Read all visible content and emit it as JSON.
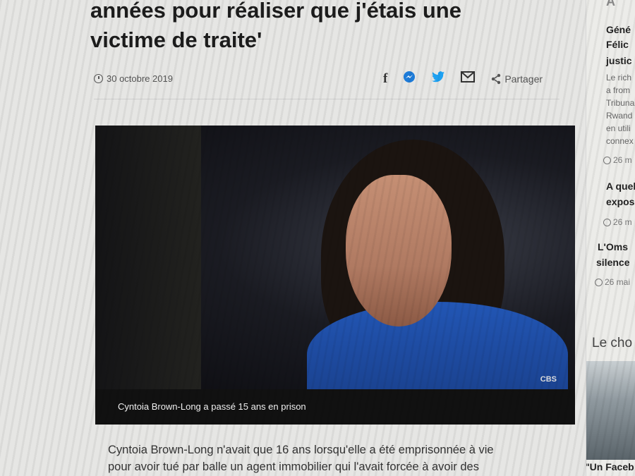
{
  "article": {
    "headline_line1": "années pour réaliser que j'étais une",
    "headline_line2": "victime de traite'",
    "date": "30 octobre 2019",
    "share_label": "Partager",
    "caption": "Cyntoia Brown-Long a passé 15 ans en prison",
    "image_credit": "CBS",
    "body_line1": "Cyntoia Brown-Long n'avait que 16 ans lorsqu'elle a été emprisonnée à vie",
    "body_line2": "pour avoir tué par balle un agent immobilier qui l'avait forcée à avoir des"
  },
  "share_icons": [
    "facebook-icon",
    "messenger-icon",
    "twitter-icon",
    "email-icon",
    "share-icon"
  ],
  "sidebar": {
    "top_partial": "A",
    "story1": {
      "line1": "Géné",
      "line2": "Félic",
      "line3": "justic",
      "snippet": [
        "Le rich",
        "a from",
        "Tribuna",
        "Rwand",
        "en utili",
        "connex"
      ],
      "time": "26 m"
    },
    "story2": {
      "line1": "A quel",
      "line2": "expose",
      "time": "26 m"
    },
    "story3": {
      "line1": "L'Oms",
      "line2": "silence",
      "time": "26 mai"
    },
    "section_title": "Le cho",
    "thumb_title": "\"Un Faceb"
  },
  "colors": {
    "messenger": "#1d7bd8",
    "twitter": "#1da1f2",
    "caption_bg": "#111111"
  }
}
